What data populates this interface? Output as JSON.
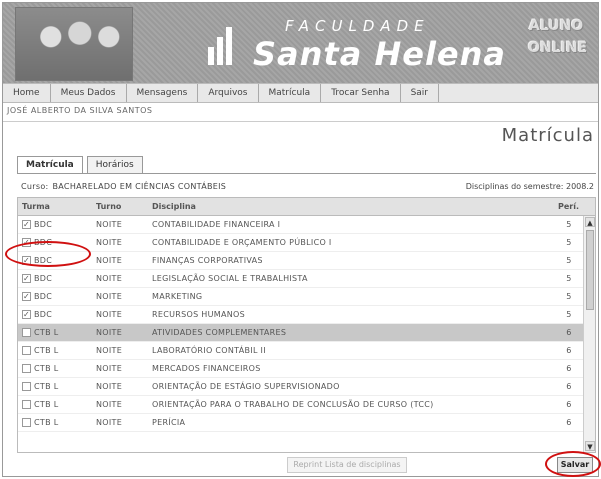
{
  "header": {
    "institution_top": "FACULDADE",
    "institution_name": "Santa Helena",
    "badge_line1": "ALUNO",
    "badge_line2": "ONLINE"
  },
  "nav": {
    "items": [
      "Home",
      "Meus Dados",
      "Mensagens",
      "Arquivos",
      "Matrícula",
      "Trocar Senha",
      "Sair"
    ]
  },
  "user_line": "JOSÉ ALBERTO DA SILVA SANTOS",
  "page_title": "Matrícula",
  "tabs": [
    "Matrícula",
    "Horários"
  ],
  "course": {
    "label": "Curso:",
    "value": "BACHARELADO EM CIÊNCIAS CONTÁBEIS"
  },
  "semester": {
    "label": "Disciplinas do semestre:",
    "value": "2008.2"
  },
  "table": {
    "headers": [
      "Turma",
      "Turno",
      "Disciplina",
      "Perí."
    ],
    "rows": [
      {
        "turma": "BDC",
        "turno": "NOITE",
        "disciplina": "CONTABILIDADE FINANCEIRA I",
        "periodo": "5",
        "checked": true
      },
      {
        "turma": "BDC",
        "turno": "NOITE",
        "disciplina": "CONTABILIDADE E ORÇAMENTO PÚBLICO I",
        "periodo": "5",
        "checked": true
      },
      {
        "turma": "BDC",
        "turno": "NOITE",
        "disciplina": "FINANÇAS CORPORATIVAS",
        "periodo": "5",
        "checked": true
      },
      {
        "turma": "BDC",
        "turno": "NOITE",
        "disciplina": "LEGISLAÇÃO SOCIAL E TRABALHISTA",
        "periodo": "5",
        "checked": true
      },
      {
        "turma": "BDC",
        "turno": "NOITE",
        "disciplina": "MARKETING",
        "periodo": "5",
        "checked": true
      },
      {
        "turma": "BDC",
        "turno": "NOITE",
        "disciplina": "RECURSOS HUMANOS",
        "periodo": "5",
        "checked": true
      },
      {
        "turma": "CTB L",
        "turno": "NOITE",
        "disciplina": "ATIVIDADES COMPLEMENTARES",
        "periodo": "6",
        "checked": false
      },
      {
        "turma": "CTB L",
        "turno": "NOITE",
        "disciplina": "LABORATÓRIO CONTÁBIL II",
        "periodo": "6",
        "checked": false
      },
      {
        "turma": "CTB L",
        "turno": "NOITE",
        "disciplina": "MERCADOS FINANCEIROS",
        "periodo": "6",
        "checked": false
      },
      {
        "turma": "CTB L",
        "turno": "NOITE",
        "disciplina": "ORIENTAÇÃO DE ESTÁGIO SUPERVISIONADO",
        "periodo": "6",
        "checked": false
      },
      {
        "turma": "CTB L",
        "turno": "NOITE",
        "disciplina": "ORIENTAÇÃO PARA O TRABALHO DE CONCLUSÃO DE CURSO (TCC)",
        "periodo": "6",
        "checked": false
      },
      {
        "turma": "CTB L",
        "turno": "NOITE",
        "disciplina": "PERÍCIA",
        "periodo": "6",
        "checked": false
      }
    ]
  },
  "buttons": {
    "reprint": "Reprint Lista de disciplinas",
    "save": "Salvar"
  },
  "colors": {
    "highlight_ring": "#d01010",
    "selected_row": "#c8c8c8"
  }
}
